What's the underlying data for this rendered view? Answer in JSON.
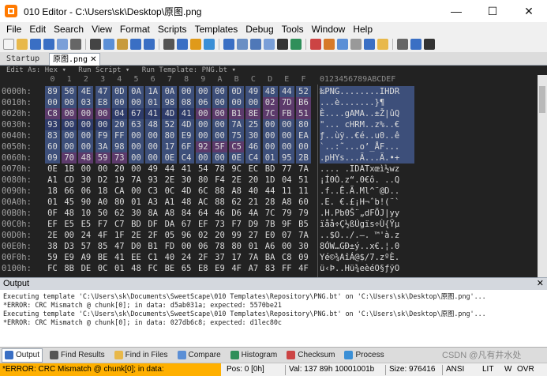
{
  "window": {
    "title": "010 Editor - C:\\Users\\sk\\Desktop\\原图.png",
    "minimize": "—",
    "maximize": "☐",
    "close": "✕"
  },
  "menu": [
    "File",
    "Edit",
    "Search",
    "View",
    "Format",
    "Scripts",
    "Templates",
    "Debug",
    "Tools",
    "Window",
    "Help"
  ],
  "tabs": {
    "startup": "Startup",
    "file": "原图.png",
    "close": "✕"
  },
  "editor_bar": {
    "edit_as": "Edit As: Hex ▾",
    "run_script": "Run Script ▾",
    "run_template": "Run Template: PNG.bt ▾"
  },
  "hex": {
    "columns": [
      "0",
      "1",
      "2",
      "3",
      "4",
      "5",
      "6",
      "7",
      "8",
      "9",
      "A",
      "B",
      "C",
      "D",
      "E",
      "F"
    ],
    "ascii_header": "0123456789ABCDEF",
    "rows": [
      {
        "offset": "0000h:",
        "bytes": [
          "89",
          "50",
          "4E",
          "47",
          "0D",
          "0A",
          "1A",
          "0A",
          "00",
          "00",
          "00",
          "0D",
          "49",
          "48",
          "44",
          "52"
        ],
        "ascii": "‰PNG........IHDR"
      },
      {
        "offset": "0010h:",
        "bytes": [
          "00",
          "00",
          "03",
          "E8",
          "00",
          "00",
          "01",
          "98",
          "08",
          "06",
          "00",
          "00",
          "00",
          "02",
          "7D",
          "B6"
        ],
        "ascii": "...è.......}¶"
      },
      {
        "offset": "0020h:",
        "bytes": [
          "C8",
          "00",
          "00",
          "00",
          "04",
          "67",
          "41",
          "4D",
          "41",
          "00",
          "00",
          "B1",
          "8E",
          "7C",
          "FB",
          "51"
        ],
        "ascii": "È....gAMA..±Ž|ûQ"
      },
      {
        "offset": "0030h:",
        "bytes": [
          "93",
          "00",
          "00",
          "00",
          "20",
          "63",
          "48",
          "52",
          "4D",
          "00",
          "00",
          "7A",
          "25",
          "00",
          "00",
          "80"
        ],
        "ascii": "\"... cHRM..z%..€"
      },
      {
        "offset": "0040h:",
        "bytes": [
          "83",
          "00",
          "00",
          "F9",
          "FF",
          "00",
          "00",
          "80",
          "E9",
          "00",
          "00",
          "75",
          "30",
          "00",
          "00",
          "EA"
        ],
        "ascii": "ƒ..ùÿ..€é..u0..ê"
      },
      {
        "offset": "0050h:",
        "bytes": [
          "60",
          "00",
          "00",
          "3A",
          "98",
          "00",
          "00",
          "17",
          "6F",
          "92",
          "5F",
          "C5",
          "46",
          "00",
          "00",
          "00"
        ],
        "ascii": "`..:˜...o’_ÅF..."
      },
      {
        "offset": "0060h:",
        "bytes": [
          "09",
          "70",
          "48",
          "59",
          "73",
          "00",
          "00",
          "0E",
          "C4",
          "00",
          "00",
          "0E",
          "C4",
          "01",
          "95",
          "2B"
        ],
        "ascii": ".pHYs...Ä...Ä.•+"
      },
      {
        "offset": "0070h:",
        "bytes": [
          "0E",
          "1B",
          "00",
          "00",
          "20",
          "00",
          "49",
          "44",
          "41",
          "54",
          "78",
          "9C",
          "EC",
          "BD",
          "77",
          "7A"
        ],
        "ascii": ".... .IDATxœì½wz"
      },
      {
        "offset": "0080h:",
        "bytes": [
          "A1",
          "CD",
          "30",
          "D2",
          "19",
          "7A",
          "93",
          "2E",
          "30",
          "80",
          "F4",
          "2E",
          "20",
          "1D",
          "04",
          "51"
        ],
        "ascii": "¡Í0Ò.z“.0€ô. ..Q"
      },
      {
        "offset": "0090h:",
        "bytes": [
          "18",
          "66",
          "06",
          "18",
          "CA",
          "00",
          "C3",
          "0C",
          "4D",
          "6C",
          "88",
          "A8",
          "40",
          "44",
          "11",
          "11"
        ],
        "ascii": ".f..Ê.Ã.Ml^¨@D.."
      },
      {
        "offset": "00A0h:",
        "bytes": [
          "01",
          "45",
          "90",
          "A0",
          "80",
          "01",
          "A3",
          "A1",
          "48",
          "AC",
          "88",
          "62",
          "21",
          "28",
          "A8",
          "60"
        ],
        "ascii": ".E. €.£¡H¬ˆb!(¨`"
      },
      {
        "offset": "00B0h:",
        "bytes": [
          "0F",
          "48",
          "10",
          "50",
          "62",
          "30",
          "8A",
          "A8",
          "84",
          "64",
          "46",
          "D6",
          "4A",
          "7C",
          "79",
          "79"
        ],
        "ascii": ".H.Pb0Š¨„dFÖJ|yy"
      },
      {
        "offset": "00C0h:",
        "bytes": [
          "EF",
          "E5",
          "E5",
          "F7",
          "C7",
          "BD",
          "DF",
          "DA",
          "67",
          "EF",
          "73",
          "F7",
          "D9",
          "7B",
          "9F",
          "B5"
        ],
        "ascii": "ïåå÷Ç½ßÚgïs÷Ù{Ÿµ"
      },
      {
        "offset": "00D0h:",
        "bytes": [
          "2E",
          "00",
          "24",
          "4F",
          "1F",
          "2E",
          "2F",
          "05",
          "96",
          "02",
          "20",
          "99",
          "27",
          "E0",
          "07",
          "7A"
        ],
        "ascii": "..$O../.–. ™'à.z"
      },
      {
        "offset": "00E0h:",
        "bytes": [
          "38",
          "D3",
          "57",
          "85",
          "47",
          "D0",
          "B1",
          "FD",
          "00",
          "06",
          "78",
          "80",
          "01",
          "A6",
          "00",
          "30"
        ],
        "ascii": "8ÓW…GÐ±ý..x€.¦.0"
      },
      {
        "offset": "00F0h:",
        "bytes": [
          "59",
          "E9",
          "A9",
          "BE",
          "41",
          "EE",
          "C1",
          "40",
          "24",
          "2F",
          "37",
          "17",
          "7A",
          "BA",
          "C8",
          "09"
        ],
        "ascii": "Yé©¾AîÁ@$/7.zºÈ."
      },
      {
        "offset": "0100h:",
        "bytes": [
          "FC",
          "8B",
          "DE",
          "0C",
          "01",
          "48",
          "FC",
          "BE",
          "65",
          "E8",
          "E9",
          "4F",
          "A7",
          "83",
          "FF",
          "4F"
        ],
        "ascii": "ü‹Þ..Hü¾eèéO§ƒÿO"
      }
    ]
  },
  "output": {
    "title": "Output",
    "close": "✕",
    "lines": [
      "Executing template 'C:\\Users\\sk\\Documents\\SweetScape\\010 Templates\\Repository\\PNG.bt' on 'C:\\Users\\sk\\Desktop\\原图.png'...",
      "*ERROR: CRC Mismatch @ chunk[0]; in data: d5ab031a; expected: 5570be21",
      "Executing template 'C:\\Users\\sk\\Documents\\SweetScape\\010 Templates\\Repository\\PNG.bt' on 'C:\\Users\\sk\\Desktop\\原图.png'...",
      "*ERROR: CRC Mismatch @ chunk[0]; in data: 027db6c8; expected: d1lec80c"
    ]
  },
  "bottom_tabs": [
    "Output",
    "Find Results",
    "Find in Files",
    "Compare",
    "Histogram",
    "Checksum",
    "Process"
  ],
  "status": {
    "error": "*ERROR: CRC Mismatch @ chunk[0]; in data:",
    "pos": "Pos: 0 [0h]",
    "val": "Val: 137 89h 10001001b",
    "size": "Size: 976416",
    "encoding": "ANSI",
    "mode": "LIT",
    "w": "W",
    "ovr": "OVR"
  },
  "watermark": "CSDN @凡有井水处",
  "colors": {
    "editor_bg": "#222222",
    "hl_blue": "#3d4f7a",
    "hl_purple": "#5c3a6b",
    "hl_navy": "#2e3b6a",
    "status_error": "#ffb000"
  }
}
